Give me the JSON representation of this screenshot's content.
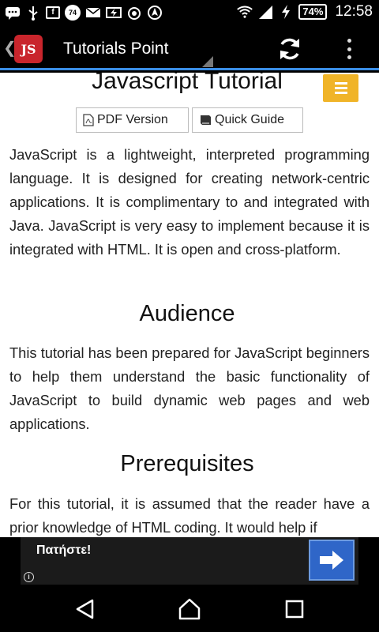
{
  "status_bar": {
    "notification_badge": "74",
    "battery": "74%",
    "time": "12:58"
  },
  "toolbar": {
    "logo_text": "JS",
    "title": "Tutorials Point"
  },
  "content": {
    "heading": "Javascript Tutorial",
    "pdf_button": "PDF Version",
    "guide_button": "Quick Guide",
    "intro": "JavaScript is a lightweight, interpreted programming language. It is designed for creating network-centric applications. It is complimentary to and integrated with Java. JavaScript is very easy to implement because it is integrated with HTML. It is open and cross-platform.",
    "audience_heading": "Audience",
    "audience_text": "This tutorial has been prepared for JavaScript beginners to help them understand the basic functionality of JavaScript to build dynamic web pages and web applications.",
    "prereq_heading": "Prerequisites",
    "prereq_text": "For this tutorial, it is assumed that the reader have a prior knowledge of HTML coding. It would help if"
  },
  "ad": {
    "text": "Πατήστε!",
    "info": "i"
  },
  "colors": {
    "toolbar_accent": "#3a8ee6",
    "logo_red": "#c9252c",
    "menu_yellow": "#f0b428",
    "ad_blue": "#2f66c8"
  }
}
